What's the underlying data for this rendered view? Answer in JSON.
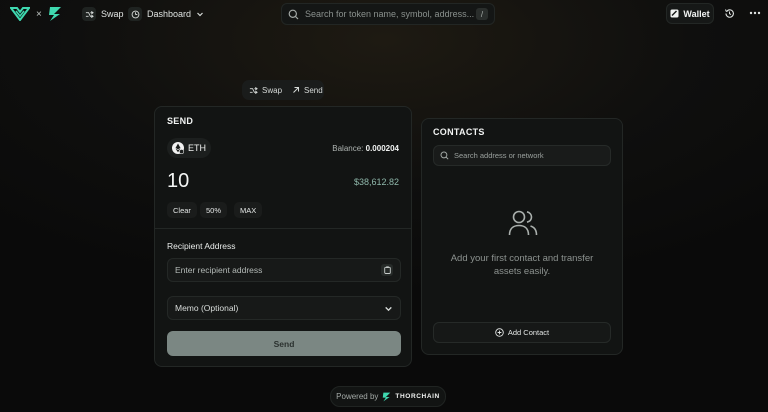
{
  "header": {
    "logo_separator": "×",
    "nav": [
      {
        "label": "Swap",
        "icon": "shuffle-icon"
      },
      {
        "label": "Dashboard",
        "icon": "gauge-icon"
      }
    ],
    "search": {
      "placeholder": "Search for token name, symbol, address...",
      "shortcut": "/"
    },
    "wallet_label": "Wallet"
  },
  "mode_switch": [
    {
      "label": "Swap",
      "icon": "shuffle-icon"
    },
    {
      "label": "Send",
      "icon": "arrow-up-right-icon"
    }
  ],
  "send": {
    "title": "SEND",
    "token": "ETH",
    "balance_label": "Balance: ",
    "balance_value": "0.000204",
    "amount": "10",
    "usd_value": "$38,612.82",
    "quick_buttons": [
      "Clear",
      "50%",
      "MAX"
    ],
    "recipient_label": "Recipient Address",
    "recipient_placeholder": "Enter recipient address",
    "memo_label": "Memo (Optional)",
    "submit_label": "Send"
  },
  "contacts": {
    "title": "CONTACTS",
    "search_placeholder": "Search address or network",
    "empty_text": "Add your first contact and transfer assets easily.",
    "add_label": "Add Contact"
  },
  "footer": {
    "powered_by": "Powered by",
    "brand": "THORCHAIN"
  },
  "colors": {
    "accent": "#3fd9b0",
    "send_button": "#7b8783",
    "usd_text": "#8fb8ab"
  }
}
